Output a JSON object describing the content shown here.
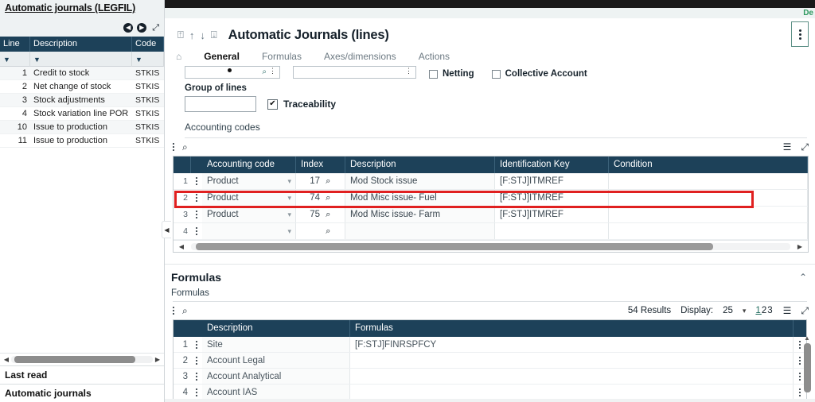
{
  "left_panel": {
    "title": "Automatic journals (LEGFIL)",
    "nav": {
      "prev_icon": "◀",
      "next_icon": "▶",
      "expand_icon": "⤢"
    },
    "columns": [
      "Line",
      "Description",
      "Code"
    ],
    "filter_icon": "filter-funnel",
    "rows": [
      {
        "line": "1",
        "description": "Credit to stock",
        "code": "STKIS"
      },
      {
        "line": "2",
        "description": "Net change of stock",
        "code": "STKIS"
      },
      {
        "line": "3",
        "description": "Stock adjustments",
        "code": "STKIS"
      },
      {
        "line": "4",
        "description": "Stock variation line POR",
        "code": "STKIS"
      },
      {
        "line": "10",
        "description": "Issue to production",
        "code": "STKIS"
      },
      {
        "line": "11",
        "description": "Issue to production",
        "code": "STKIS"
      }
    ],
    "footer": {
      "last_read": "Last read",
      "last_read_item": "Automatic journals"
    }
  },
  "topbar": {
    "right_label": "De"
  },
  "header": {
    "title": "Automatic Journals (lines)",
    "nav_first": "⍐",
    "nav_prev": "↑",
    "nav_next": "↓",
    "nav_last": "⍗",
    "kebab_label": "more-actions"
  },
  "tabs": {
    "home_icon": "⌂",
    "items": [
      {
        "label": "General",
        "active": true
      },
      {
        "label": "Formulas",
        "active": false
      },
      {
        "label": "Axes/dimensions",
        "active": false
      },
      {
        "label": "Actions",
        "active": false
      }
    ]
  },
  "clipped_fields": {
    "netting_label": "Netting",
    "collective_account_label": "Collective Account"
  },
  "general": {
    "group_of_lines_label": "Group of lines",
    "group_of_lines_value": "",
    "traceability_label": "Traceability",
    "traceability_checked": "✔",
    "accounting_codes_label": "Accounting codes"
  },
  "accounting_grid": {
    "toolbar": {
      "menu_icon": "kebab-menu",
      "search_icon": "⌕",
      "layers_icon": "layers",
      "expand_icon": "⤢"
    },
    "columns": [
      "Accounting code",
      "Index",
      "Description",
      "Identification Key",
      "Condition"
    ],
    "rows": [
      {
        "num": "1",
        "code": "Product",
        "index": "17",
        "description": "Mod Stock issue",
        "idkey": "[F:STJ]ITMREF",
        "condition": ""
      },
      {
        "num": "2",
        "code": "Product",
        "index": "74",
        "description": "Mod Misc issue- Fuel",
        "idkey": "[F:STJ]ITMREF",
        "condition": ""
      },
      {
        "num": "3",
        "code": "Product",
        "index": "75",
        "description": "Mod Misc issue- Farm",
        "idkey": "[F:STJ]ITMREF",
        "condition": ""
      },
      {
        "num": "4",
        "code": "",
        "index": "",
        "description": "",
        "idkey": "",
        "condition": ""
      }
    ],
    "highlighted_row_index": 3,
    "highlight_color": "#e02020"
  },
  "formulas_panel": {
    "title": "Formulas",
    "collapse_icon": "⌃",
    "subtitle": "Formulas",
    "toolbar": {
      "menu_icon": "kebab-menu",
      "search_icon": "⌕",
      "results_text": "54 Results",
      "display_label": "Display:",
      "display_value": "25",
      "caret": "▾",
      "pages": [
        "1",
        "2",
        "3"
      ],
      "current_page": "1",
      "layers_icon": "layers",
      "expand_icon": "⤢"
    },
    "columns": [
      "Description",
      "Formulas"
    ],
    "rows": [
      {
        "num": "1",
        "description": "Site",
        "formula": "[F:STJ]FINRSPFCY"
      },
      {
        "num": "2",
        "description": "Account Legal",
        "formula": ""
      },
      {
        "num": "3",
        "description": "Account Analytical",
        "formula": ""
      },
      {
        "num": "4",
        "description": "Account IAS",
        "formula": ""
      }
    ]
  },
  "colors": {
    "header_blue": "#1d4159",
    "accent_green": "#2e9960",
    "highlight_red": "#e02020"
  }
}
